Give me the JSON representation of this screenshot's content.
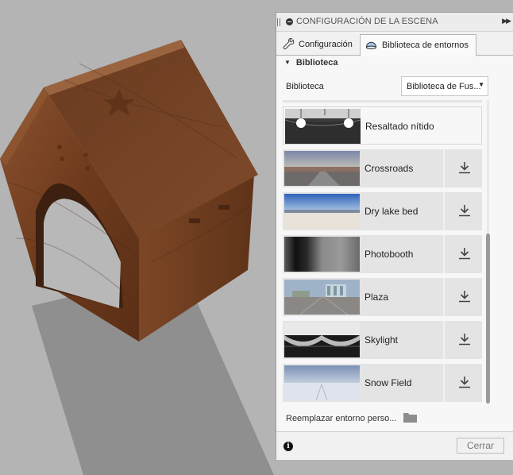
{
  "panel": {
    "title": "CONFIGURACIÓN DE LA ESCENA",
    "tabs": [
      {
        "label": "Configuración",
        "icon": "wrench-icon"
      },
      {
        "label": "Biblioteca de entornos",
        "icon": "dome-icon"
      }
    ],
    "section_title": "Biblioteca",
    "library_label": "Biblioteca",
    "library_select_value": "Biblioteca de Fus...",
    "environments": [
      {
        "name": "Resaltado nítido",
        "selected": true
      },
      {
        "name": "Crossroads",
        "download": true
      },
      {
        "name": "Dry lake bed",
        "download": true
      },
      {
        "name": "Photobooth",
        "download": true
      },
      {
        "name": "Plaza",
        "download": true
      },
      {
        "name": "Skylight",
        "download": true
      },
      {
        "name": "Snow Field",
        "download": true
      }
    ],
    "replace_link": "Reemplazar entorno perso...",
    "close_button": "Cerrar"
  },
  "colors": {
    "panel_bg": "#f1f1f1",
    "row_bg": "#e4e4e4",
    "viewport_bg": "#b4b4b4",
    "wood": "#7a4424"
  }
}
